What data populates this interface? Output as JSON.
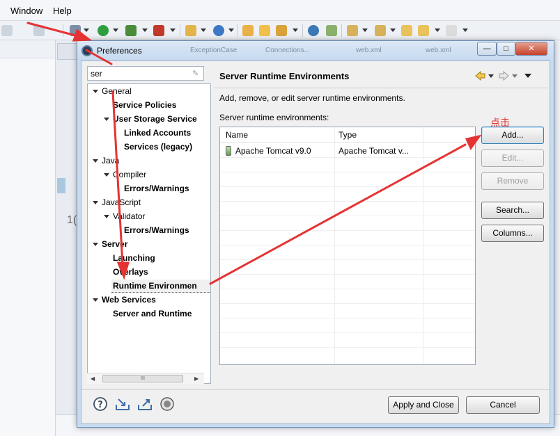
{
  "ide": {
    "menu": {
      "window": "Window",
      "help": "Help"
    },
    "bg_line_number": "1("
  },
  "dialog": {
    "title": "Preferences",
    "ghost_tabs": [
      "ExceptionCase",
      "Connections...",
      "web.xml",
      "web.xml"
    ],
    "filter": {
      "value": "ser"
    },
    "tree": [
      {
        "label": "General",
        "level": 0,
        "bold": false,
        "expanded": true
      },
      {
        "label": "Service Policies",
        "level": 1,
        "bold": true
      },
      {
        "label": "User Storage Service",
        "level": 1,
        "bold": true,
        "expanded": true
      },
      {
        "label": "Linked Accounts",
        "level": 2,
        "bold": true
      },
      {
        "label": "Services (legacy)",
        "level": 2,
        "bold": true
      },
      {
        "label": "Java",
        "level": 0,
        "bold": false,
        "expanded": true
      },
      {
        "label": "Compiler",
        "level": 1,
        "bold": false,
        "expanded": true
      },
      {
        "label": "Errors/Warnings",
        "level": 2,
        "bold": true
      },
      {
        "label": "JavaScript",
        "level": 0,
        "bold": false,
        "expanded": true
      },
      {
        "label": "Validator",
        "level": 1,
        "bold": false,
        "expanded": true
      },
      {
        "label": "Errors/Warnings",
        "level": 2,
        "bold": true
      },
      {
        "label": "Server",
        "level": 0,
        "bold": true,
        "expanded": true
      },
      {
        "label": "Launching",
        "level": 1,
        "bold": true
      },
      {
        "label": "Overlays",
        "level": 1,
        "bold": true
      },
      {
        "label": "Runtime Environmen",
        "level": 1,
        "bold": true,
        "selected": true
      },
      {
        "label": "Web Services",
        "level": 0,
        "bold": true,
        "expanded": true
      },
      {
        "label": "Server and Runtime",
        "level": 1,
        "bold": true
      }
    ],
    "scroll_thumb": "III",
    "page": {
      "title": "Server Runtime Environments",
      "description": "Add, remove, or edit server runtime environments.",
      "table_label": "Server runtime environments:",
      "columns": [
        "Name",
        "Type"
      ],
      "rows": [
        {
          "name": "Apache Tomcat v9.0",
          "type": "Apache Tomcat v..."
        }
      ],
      "buttons": {
        "add": "Add...",
        "edit": "Edit...",
        "remove": "Remove",
        "search": "Search...",
        "columns": "Columns..."
      }
    },
    "footer": {
      "apply_close": "Apply and Close",
      "cancel": "Cancel"
    }
  },
  "annotation": {
    "text": "点击",
    "color": "#e53333"
  }
}
